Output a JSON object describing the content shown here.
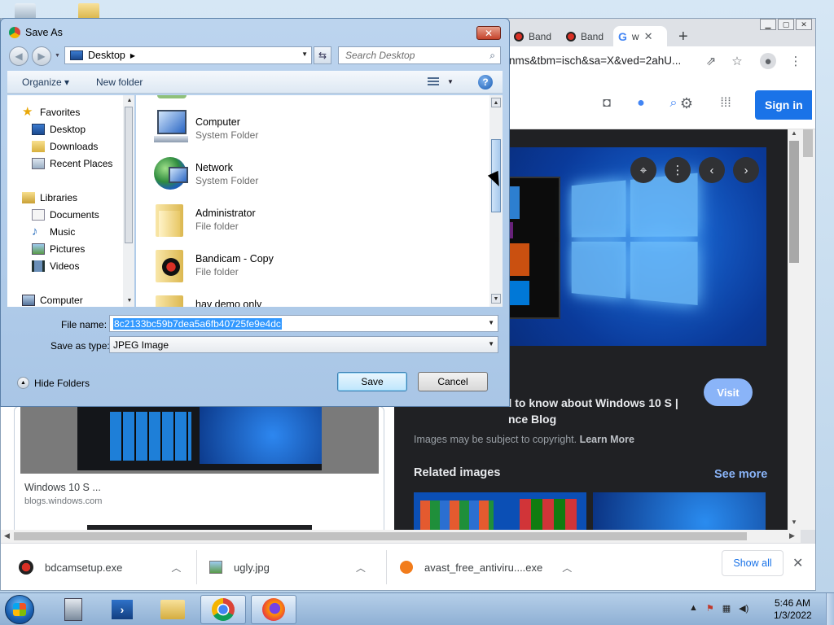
{
  "dialog": {
    "title": "Save As",
    "close_label": "✕",
    "location": "Desktop",
    "search_placeholder": "Search Desktop",
    "organize_label": "Organize ▾",
    "new_folder_label": "New folder",
    "help_label": "?",
    "nav": {
      "favorites": "Favorites",
      "desktop": "Desktop",
      "downloads": "Downloads",
      "recent_places": "Recent Places",
      "libraries": "Libraries",
      "documents": "Documents",
      "music": "Music",
      "pictures": "Pictures",
      "videos": "Videos",
      "computer": "Computer"
    },
    "files": [
      {
        "name": "Computer",
        "type": "System Folder"
      },
      {
        "name": "Network",
        "type": "System Folder"
      },
      {
        "name": "Administrator",
        "type": "File folder"
      },
      {
        "name": "Bandicam - Copy",
        "type": "File folder"
      },
      {
        "name": "hay demo only",
        "type": ""
      }
    ],
    "file_name_label": "File name:",
    "file_name_value": "8c2133bc59b7dea5a6fb40725fe9e4dc",
    "save_type_label": "Save as type:",
    "save_type_value": "JPEG Image",
    "hide_folders_label": "Hide Folders",
    "save_label": "Save",
    "cancel_label": "Cancel"
  },
  "browser": {
    "tabs": [
      {
        "label": "Band"
      },
      {
        "label": "Band"
      },
      {
        "label": "w"
      }
    ],
    "new_tab": "+",
    "address_fragment": "nms&tbm=isch&sa=X&ved=2ahU...",
    "sign_in": "Sign in",
    "result": {
      "title": "Windows 10 S ...",
      "source": "blogs.windows.com"
    },
    "panel": {
      "visit_label": "Visit",
      "title_line1": "ed to know about Windows 10 S |",
      "title_line2": "nce Blog",
      "copyright_text": "Images may be subject to copyright.",
      "learn_more": "Learn More",
      "related_label": "Related images",
      "see_more": "See more"
    },
    "downloads": [
      {
        "name": "bdcamsetup.exe"
      },
      {
        "name": "ugly.jpg"
      },
      {
        "name": "avast_free_antiviru....exe"
      }
    ],
    "show_all": "Show all",
    "close_label": "✕"
  },
  "taskbar": {
    "time": "5:46 AM",
    "date": "1/3/2022"
  },
  "colors": {
    "accent": "#1a73e8",
    "panel_bg": "#202124",
    "dialog_frame": "#a9c6e6"
  }
}
